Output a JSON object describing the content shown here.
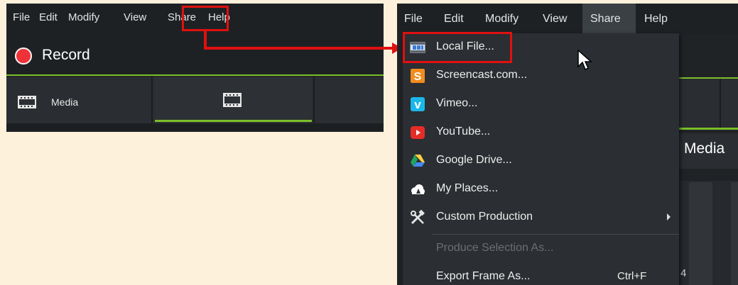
{
  "left_panel": {
    "menu": [
      "File",
      "Edit",
      "Modify",
      "View",
      "Share",
      "Help"
    ],
    "record_label": "Record",
    "media_tab_label": "Media"
  },
  "right_panel": {
    "menu": [
      "File",
      "Edit",
      "Modify",
      "View",
      "Share",
      "Help"
    ],
    "background_media_label": "Media",
    "background_number": "4",
    "share_menu": {
      "items": [
        {
          "label": "Local File...",
          "icon": "local-file-icon"
        },
        {
          "label": "Screencast.com...",
          "icon": "screencast-icon"
        },
        {
          "label": "Vimeo...",
          "icon": "vimeo-icon"
        },
        {
          "label": "YouTube...",
          "icon": "youtube-icon"
        },
        {
          "label": "Google Drive...",
          "icon": "google-drive-icon"
        },
        {
          "label": "My Places...",
          "icon": "my-places-icon"
        },
        {
          "label": "Custom Production",
          "icon": "custom-production-icon"
        },
        {
          "label": "Produce Selection As..."
        },
        {
          "label": "Export Frame As...",
          "shortcut": "Ctrl+F"
        }
      ]
    }
  },
  "colors": {
    "background": "#fdf1dc",
    "panel": "#1e2124",
    "highlight_box": "#e01010",
    "accent_green": "#7bbf2a",
    "record_red": "#ef3138"
  }
}
